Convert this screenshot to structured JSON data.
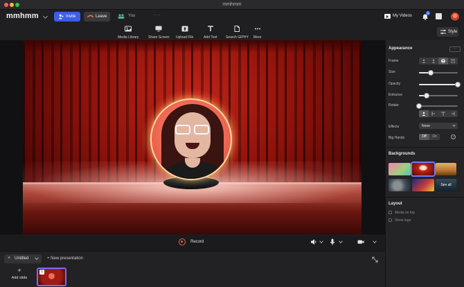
{
  "window": {
    "title": "mmhmm"
  },
  "header": {
    "logo": "mmhmm",
    "invite_label": "Invite",
    "leave_label": "Leave",
    "you_label": "You",
    "my_videos_label": "My Videos",
    "notification_count": "1"
  },
  "toolbar": {
    "items": [
      {
        "label": "Media Library",
        "icon": "media-library-icon"
      },
      {
        "label": "Share Screen",
        "icon": "share-screen-icon"
      },
      {
        "label": "Upload File",
        "icon": "upload-file-icon"
      },
      {
        "label": "Add Text",
        "icon": "add-text-icon"
      },
      {
        "label": "Search GIPHY",
        "icon": "giphy-icon"
      },
      {
        "label": "More",
        "icon": "more-icon"
      }
    ],
    "style_label": "Style"
  },
  "bottom_controls": {
    "record_label": "Record"
  },
  "panel": {
    "appearance_title": "Appearance",
    "more_label": "···",
    "frame_label": "Frame",
    "size_label": "Size",
    "size_value": 0.3,
    "opacity_label": "Opacity",
    "opacity_value": 1.0,
    "entrance_label": "Entrance",
    "entrance_value": 0.2,
    "rotate_label": "Rotate",
    "rotate_value": 0.0,
    "effects_label": "Effects",
    "effects_value": "None",
    "big_hands_label": "Big Hands",
    "big_hands_off": "Off",
    "big_hands_on": "On",
    "backgrounds_title": "Backgrounds",
    "see_all_label": "See all",
    "layout_title": "Layout",
    "layout_items": [
      "Media on top",
      "Show logo"
    ]
  },
  "slides": {
    "presentation_name": "Untitled",
    "new_presentation_label": "+ New presentation",
    "add_slide_label": "Add slide",
    "slide_numbers": [
      "1"
    ]
  },
  "colors": {
    "accent": "#3d5ee8",
    "selection": "#6d7cff",
    "record": "#ff5c4a",
    "stage_red": "#c02418"
  }
}
